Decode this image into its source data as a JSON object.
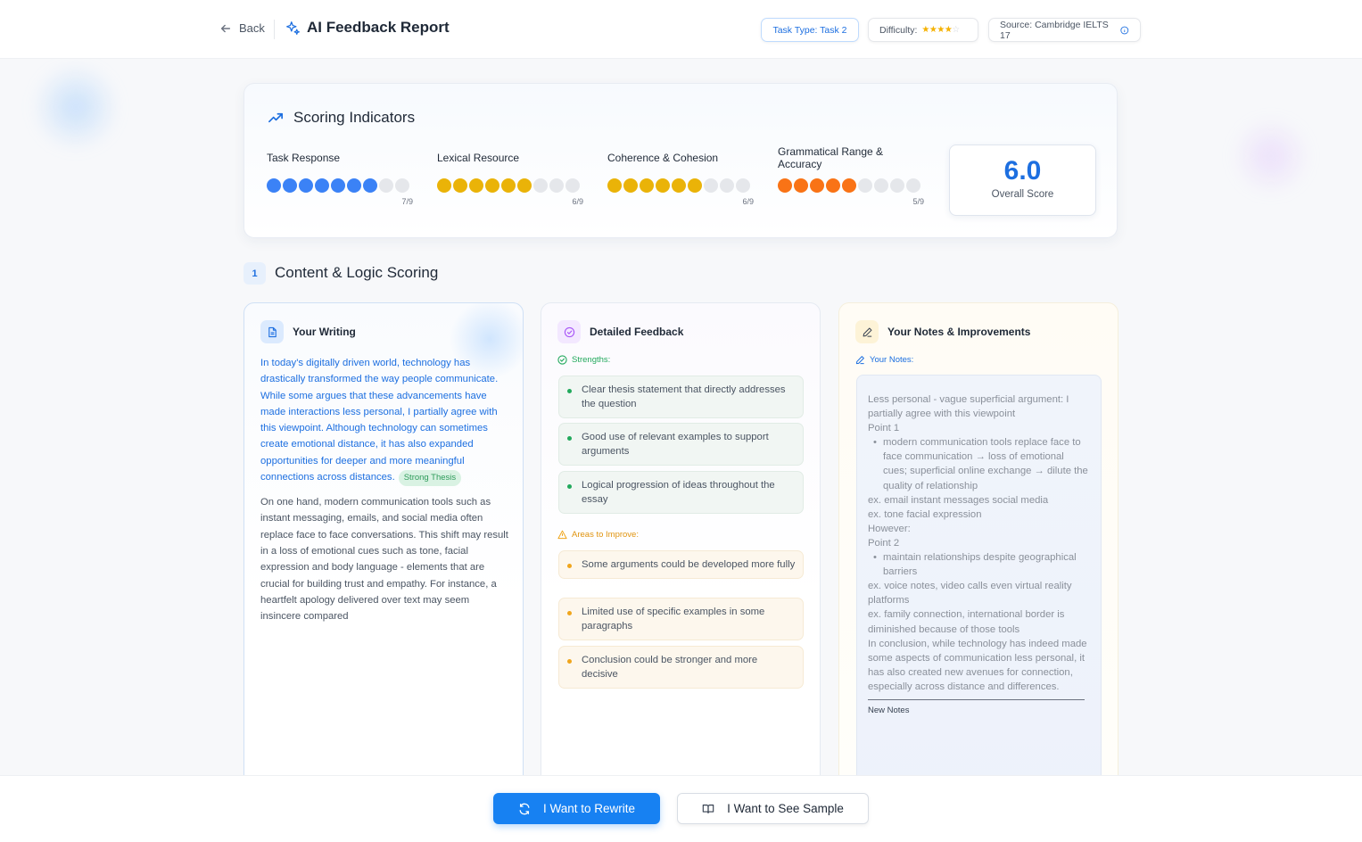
{
  "header": {
    "back_label": "Back",
    "title": "AI Feedback Report",
    "task_type": "Task Type: Task 2",
    "difficulty_label": "Difficulty:",
    "difficulty_stars": 4,
    "difficulty_max": 5,
    "source": "Source: Cambridge IELTS 17"
  },
  "scoring": {
    "title": "Scoring Indicators",
    "indicators": [
      {
        "label": "Task Response",
        "score": 7,
        "max": 9,
        "value_text": "7/9",
        "color": "#3b82f6"
      },
      {
        "label": "Lexical Resource",
        "score": 6,
        "max": 9,
        "value_text": "6/9",
        "color": "#eab308"
      },
      {
        "label": "Coherence & Cohesion",
        "score": 6,
        "max": 9,
        "value_text": "6/9",
        "color": "#eab308"
      },
      {
        "label": "Grammatical Range & Accuracy",
        "score": 5,
        "max": 9,
        "value_text": "5/9",
        "color": "#f97316"
      }
    ],
    "overall_score": "6.0",
    "overall_label": "Overall Score"
  },
  "section": {
    "number": "1",
    "title": "Content & Logic Scoring"
  },
  "writing": {
    "title": "Your Writing",
    "intro": "In today's digitally driven world, technology has drastically transformed the way people communicate. While some argues that these advancements have made interactions less personal, I partially agree with this viewpoint. Although technology can sometimes create emotional distance, it has also expanded opportunities for deeper and more meaningful connections across distances.",
    "intro_tag": "Strong Thesis",
    "body": "On one hand, modern communication tools such as instant messaging, emails, and social media often replace face to face conversations. This shift may result in a loss of emotional cues such as tone, facial expression and body language - elements that are crucial for building trust and empathy. For instance, a heartfelt apology delivered over text may seem insincere compared"
  },
  "feedback": {
    "title": "Detailed Feedback",
    "strengths_label": "Strengths:",
    "strengths": [
      "Clear thesis statement that directly addresses the question",
      "Good use of relevant examples to support arguments",
      "Logical progression of ideas throughout the essay"
    ],
    "improve_label": "Areas to Improve:",
    "improvements": [
      "Some arguments could be developed more fully",
      "Limited use of specific examples in some paragraphs",
      "Conclusion could be stronger and more decisive"
    ]
  },
  "notes": {
    "title": "Your Notes & Improvements",
    "label": "Your Notes:",
    "lines": [
      {
        "text": "Less personal - vague superficial argument: I partially agree with this viewpoint",
        "bullet": false
      },
      {
        "text": "Point 1",
        "bullet": false
      },
      {
        "text": "modern communication tools replace face to face communication → loss of emotional cues; superficial online exchange → dilute the quality of relationship",
        "bullet": true
      },
      {
        "text": "ex. email instant messages social media",
        "bullet": false
      },
      {
        "text": "ex. tone facial expression",
        "bullet": false
      },
      {
        "text": "However:",
        "bullet": false
      },
      {
        "text": "Point 2",
        "bullet": false
      },
      {
        "text": "maintain relationships despite geographical barriers",
        "bullet": true
      },
      {
        "text": "ex. voice notes, video calls even virtual reality platforms",
        "bullet": false
      },
      {
        "text": "ex. family connection, international border is diminished because of those tools",
        "bullet": false
      },
      {
        "text": "In conclusion, while technology has indeed made some aspects of communication less personal, it has also created new avenues for connection, especially across distance and differences.",
        "bullet": false
      }
    ],
    "new_notes_label": "New Notes"
  },
  "actions": {
    "rewrite_label": "I Want to Rewrite",
    "sample_label": "I Want to See Sample"
  },
  "colors": {
    "accent": "#1781f2",
    "strength": "#22a95c",
    "warning": "#f0a51c"
  }
}
